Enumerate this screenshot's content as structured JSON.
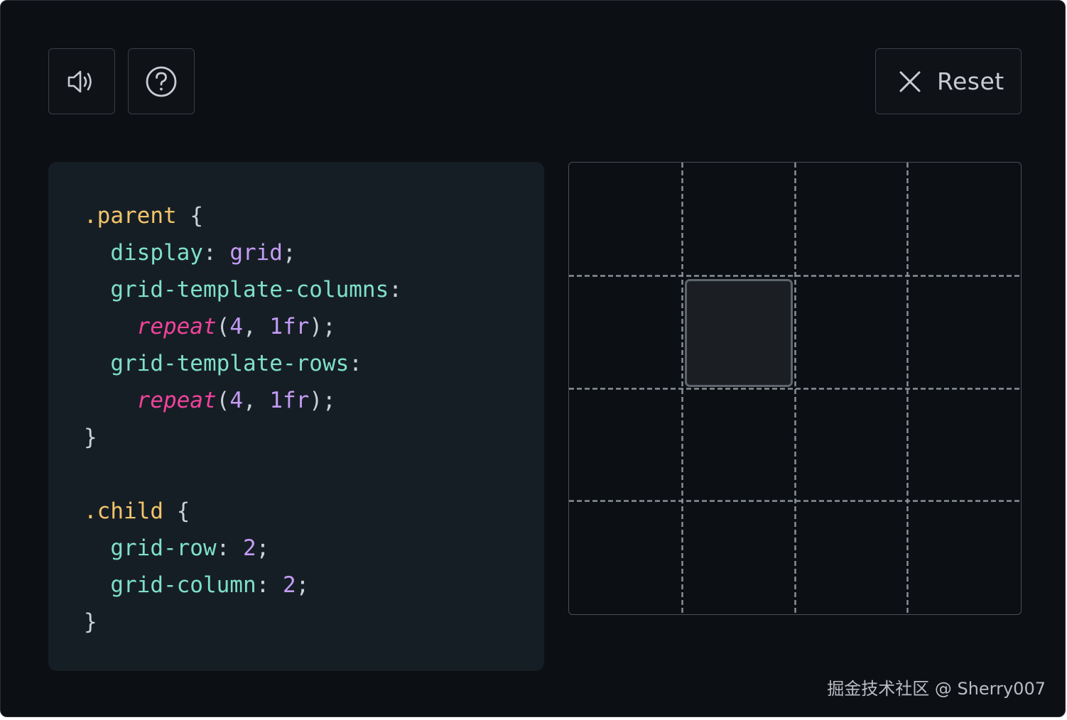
{
  "toolbar": {
    "sound_icon": "speaker-icon",
    "help_icon": "question-icon",
    "reset_label": "Reset",
    "reset_icon": "close-icon"
  },
  "code": {
    "parent_selector": ".parent",
    "open_brace": "{",
    "close_brace": "}",
    "display_prop": "display",
    "display_value": "grid",
    "columns_prop": "grid-template-columns",
    "rows_prop": "grid-template-rows",
    "repeat_fn": "repeat",
    "repeat_args_count": "4",
    "repeat_args_size": "1fr",
    "child_selector": ".child",
    "row_prop": "grid-row",
    "row_value": "2",
    "column_prop": "grid-column",
    "column_value": "2"
  },
  "grid": {
    "columns": 4,
    "rows": 4,
    "child_row": 2,
    "child_column": 2
  },
  "watermark": "掘金技术社区 @ Sherry007",
  "colors": {
    "background": "#0c0f13",
    "code_panel": "#161e25",
    "selector": "#f2c56b",
    "property": "#7fe0cc",
    "value": "#c49cf5",
    "function": "#f0439b"
  }
}
